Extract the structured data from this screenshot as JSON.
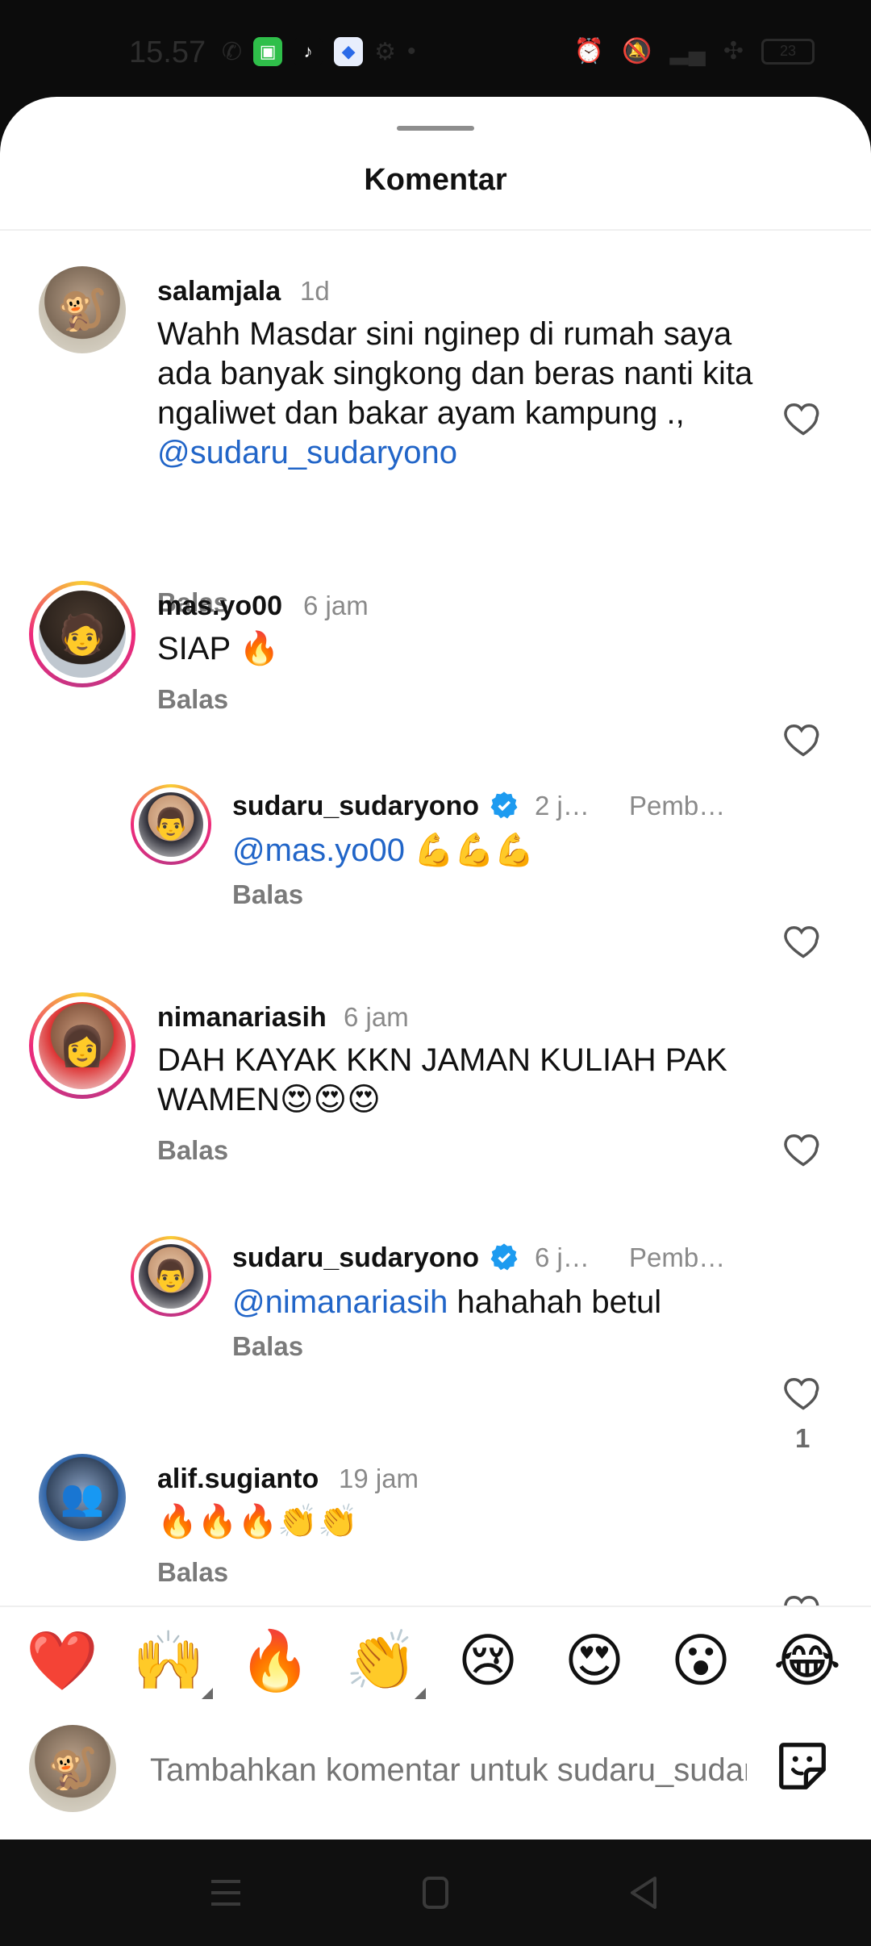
{
  "status_bar": {
    "time": "15.57",
    "battery": "23"
  },
  "sheet": {
    "title": "Komentar"
  },
  "comments": [
    {
      "username": "salamjala",
      "time": "1d",
      "text": "Wahh Masdar sini nginep di rumah saya ada banyak singkong dan beras nanti kita ngaliwet dan bakar ayam kampung ., ",
      "mention": "@sudaru_sudaryono",
      "reply_label": "Balas"
    },
    {
      "username": "mas.yo00",
      "time": "6 jam",
      "text": "SIAP 🔥",
      "reply_label": "Balas"
    },
    {
      "username": "sudaru_sudaryono",
      "time": "2 j…",
      "pinned": "Pemb…",
      "mention": "@mas.yo00",
      "text": " 💪💪💪",
      "reply_label": "Balas"
    },
    {
      "username": "nimanariasih",
      "time": "6 jam",
      "text": "DAH KAYAK KKN JAMAN KULIAH PAK WAMEN😍😍😍",
      "reply_label": "Balas"
    },
    {
      "username": "sudaru_sudaryono",
      "time": "6 j…",
      "pinned": "Pemb…",
      "mention": "@nimanariasih",
      "text": " hahahah betul",
      "reply_label": "Balas",
      "like_count": "1"
    },
    {
      "username": "alif.sugianto",
      "time": "19 jam",
      "text": "🔥🔥🔥👏👏",
      "reply_label": "Balas"
    }
  ],
  "emoji_bar": [
    "❤️",
    "🙌",
    "🔥",
    "👏",
    "😢",
    "😍",
    "😮",
    "😂"
  ],
  "composer": {
    "placeholder": "Tambahkan komentar untuk sudaru_sudaryono..."
  },
  "colors": {
    "mention": "#2165c8",
    "verified": "#1d9bf0"
  }
}
